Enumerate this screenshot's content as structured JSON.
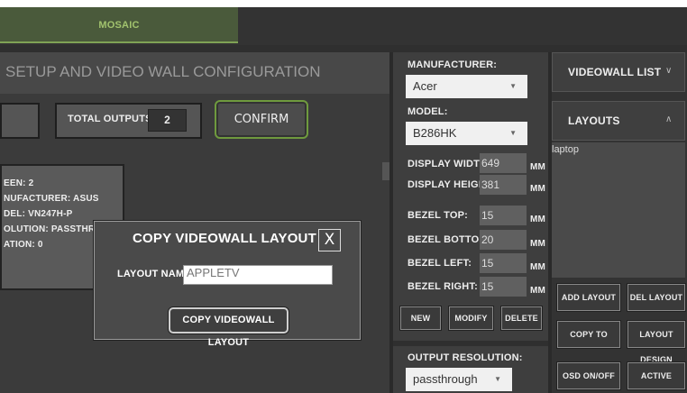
{
  "nav": {
    "mosaic_tab": "MOSAIC"
  },
  "setup": {
    "title": "SETUP AND VIDEO WALL CONFIGURATION",
    "total_outputs_label": "TOTAL OUTPUTS =",
    "total_outputs_value": "2",
    "confirm_label": "CONFIRM"
  },
  "screen_card": {
    "lines": [
      "EEN: 2",
      "NUFACTURER: ASUS",
      "DEL: VN247H-P",
      "OLUTION: PASSTHROU",
      "ATION: 0"
    ]
  },
  "modal": {
    "title": "COPY VIDEOWALL LAYOUT",
    "close_label": "X",
    "layout_name_label": "LAYOUT NAME:",
    "layout_name_value": "APPLETV",
    "copy_button": "COPY VIDEOWALL LAYOUT"
  },
  "props": {
    "manufacturer_label": "MANUFACTURER:",
    "manufacturer_value": "Acer",
    "model_label": "MODEL:",
    "model_value": "B286HK",
    "display_width_label": "DISPLAY WIDTH:",
    "display_width_value": "649",
    "display_height_label": "DISPLAY HEIGHT:",
    "display_height_value": "381",
    "bezel_top_label": "BEZEL TOP:",
    "bezel_top_value": "15",
    "bezel_bottom_label": "BEZEL BOTTOM:",
    "bezel_bottom_value": "20",
    "bezel_left_label": "BEZEL LEFT:",
    "bezel_left_value": "15",
    "bezel_right_label": "BEZEL RIGHT:",
    "bezel_right_value": "15",
    "unit": "MM",
    "new_btn": "NEW",
    "modify_btn": "MODIFY",
    "delete_btn": "DELETE",
    "output_resolution_label": "OUTPUT RESOLUTION:",
    "output_resolution_value": "passthrough"
  },
  "right": {
    "videowall_list_label": "VIDEOWALL LIST",
    "layouts_label": "LAYOUTS",
    "layouts": [
      "laptop"
    ],
    "add_layout": "ADD LAYOUT",
    "del_layout": "DEL LAYOUT",
    "copy_to": "COPY TO",
    "layout_design": "LAYOUT DESIGN",
    "osd": "OSD ON/OFF",
    "active": "ACTIVE"
  },
  "icons": {
    "dropdown_caret": "caret-down-icon",
    "collapse_caret": "chevron-up-icon",
    "expand_caret": "chevron-down-icon"
  },
  "colors": {
    "accent_green": "#7fa255",
    "mosaic_text": "#a2c36e",
    "panel_dark": "#3a3a3a"
  }
}
